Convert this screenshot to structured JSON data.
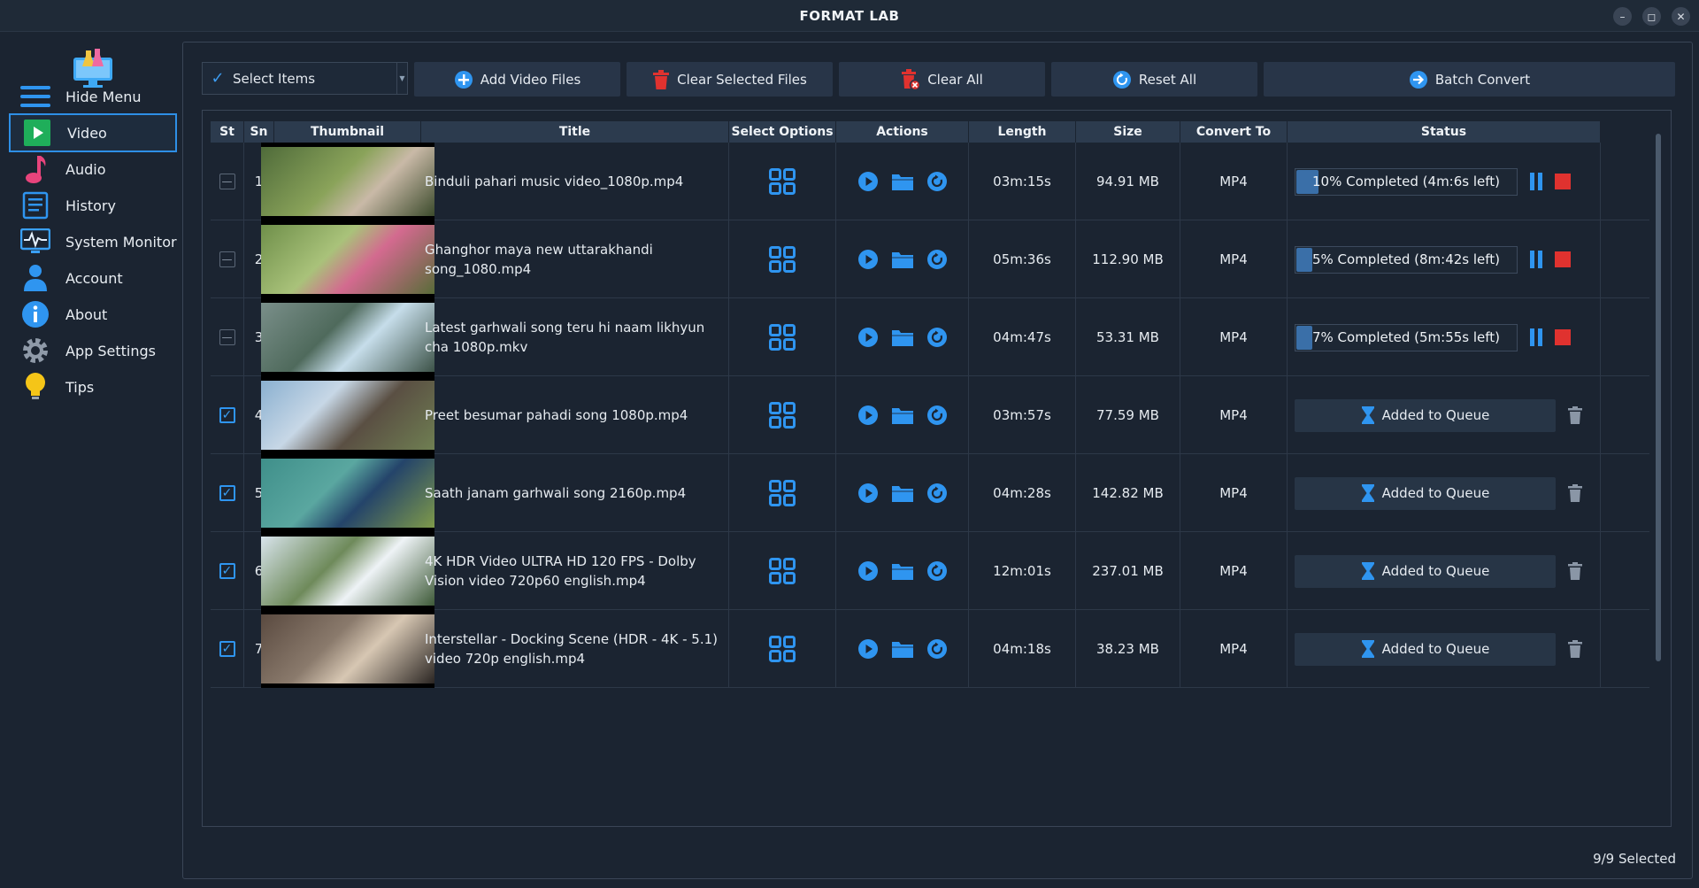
{
  "app": {
    "title": "FORMAT LAB"
  },
  "window_controls": {
    "minimize": "–",
    "maximize": "◻",
    "close": "✕"
  },
  "sidebar": {
    "items": [
      {
        "label": "Hide Menu",
        "icon": "menu-icon"
      },
      {
        "label": "Video",
        "icon": "play-icon",
        "active": true
      },
      {
        "label": "Audio",
        "icon": "music-note-icon"
      },
      {
        "label": "History",
        "icon": "history-icon"
      },
      {
        "label": "System Monitor",
        "icon": "monitor-icon"
      },
      {
        "label": "Account",
        "icon": "user-icon"
      },
      {
        "label": "About",
        "icon": "info-icon"
      },
      {
        "label": "App Settings",
        "icon": "gear-icon"
      },
      {
        "label": "Tips",
        "icon": "lightbulb-icon"
      }
    ]
  },
  "toolbar": {
    "select_items": "Select Items",
    "add_video": "Add Video Files",
    "clear_selected": "Clear Selected Files",
    "clear_all": "Clear All",
    "reset_all": "Reset All",
    "batch_convert": "Batch Convert"
  },
  "table": {
    "columns": [
      "St",
      "Sn",
      "Thumbnail",
      "Title",
      "Select Options",
      "Actions",
      "Length",
      "Size",
      "Convert To",
      "Status"
    ],
    "rows": [
      {
        "checked": false,
        "sn": "1",
        "title": "Binduli pahari music video_1080p.mp4",
        "length": "03m:15s",
        "size": "94.91 MB",
        "format": "MP4",
        "status": "10% Completed (4m:6s left)",
        "progress": 0.1,
        "queued": false
      },
      {
        "checked": false,
        "sn": "2",
        "title": "Ghanghor maya new uttarakhandi song_1080.mp4",
        "length": "05m:36s",
        "size": "112.90 MB",
        "format": "MP4",
        "status": "5% Completed (8m:42s left)",
        "progress": 0.05,
        "queued": false
      },
      {
        "checked": false,
        "sn": "3",
        "title": "Latest garhwali song teru hi naam likhyun cha 1080p.mkv",
        "length": "04m:47s",
        "size": "53.31 MB",
        "format": "MP4",
        "status": "7% Completed (5m:55s left)",
        "progress": 0.07,
        "queued": false
      },
      {
        "checked": true,
        "sn": "4",
        "title": "Preet besumar pahadi song 1080p.mp4",
        "length": "03m:57s",
        "size": "77.59 MB",
        "format": "MP4",
        "status": "Added to Queue",
        "progress": 0,
        "queued": true
      },
      {
        "checked": true,
        "sn": "5",
        "title": "Saath janam garhwali song 2160p.mp4",
        "length": "04m:28s",
        "size": "142.82 MB",
        "format": "MP4",
        "status": "Added to Queue",
        "progress": 0,
        "queued": true
      },
      {
        "checked": true,
        "sn": "6",
        "title": "4K HDR Video ULTRA HD 120 FPS - Dolby Vision video 720p60 english.mp4",
        "length": "12m:01s",
        "size": "237.01 MB",
        "format": "MP4",
        "status": "Added to Queue",
        "progress": 0,
        "queued": true
      },
      {
        "checked": true,
        "sn": "7",
        "title": "Interstellar - Docking Scene (HDR - 4K - 5.1) video 720p english.mp4",
        "length": "04m:18s",
        "size": "38.23 MB",
        "format": "MP4",
        "status": "Added to Queue",
        "progress": 0,
        "queued": true
      }
    ]
  },
  "footer": {
    "selection_count": "9/9 Selected"
  },
  "colors": {
    "accent": "#2f95f0",
    "background": "#1b2431",
    "header": "#2c3b4e",
    "danger": "#e0322f",
    "button": "#283548"
  }
}
